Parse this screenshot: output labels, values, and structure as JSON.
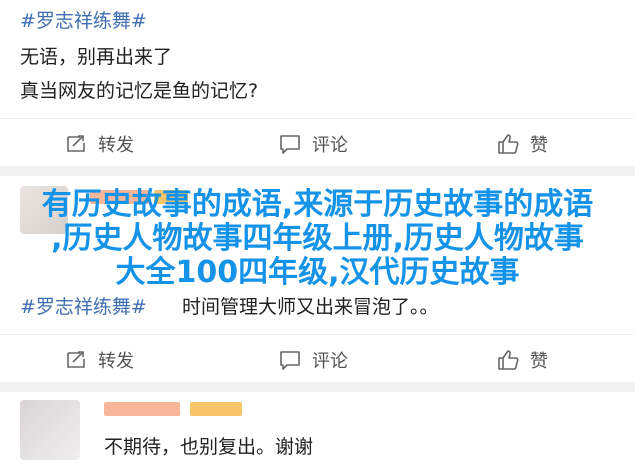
{
  "post1": {
    "tag": "#罗志祥练舞#",
    "line1": "无语，别再出来了",
    "line2": "真当网友的记忆是鱼的记忆?"
  },
  "actions": {
    "repost": "转发",
    "comment": "评论",
    "like": "赞"
  },
  "overlay": {
    "line1": "有历史故事的成语,来源于历史故事的成语",
    "line2": ",历史人物故事四年级上册,历史人物故事",
    "line3": "大全100四年级,汉代历史故事"
  },
  "post2": {
    "tag": "#罗志祥练舞#",
    "text": "时间管理大师又出来冒泡了。。"
  },
  "post3": {
    "text": "不期待，也别复出。谢谢"
  },
  "colors": {
    "link": "#3f6fb0",
    "overlay": "#1593e8",
    "separator": "#f2f2f2"
  }
}
